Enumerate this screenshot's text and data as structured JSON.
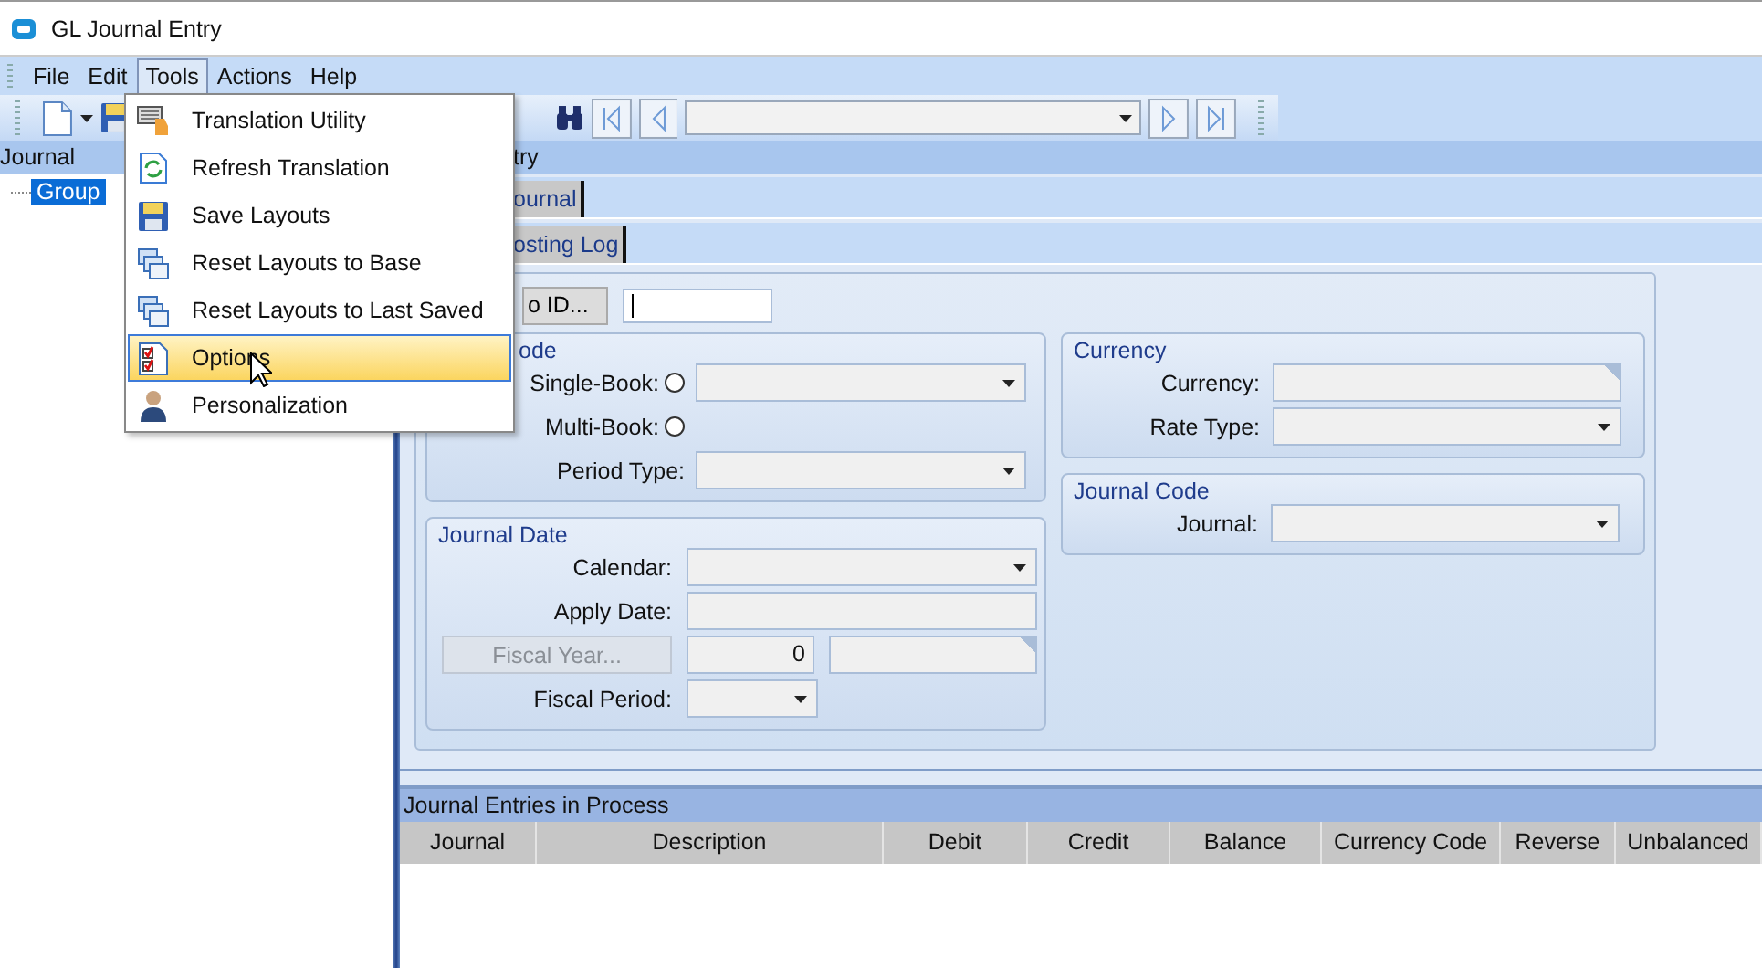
{
  "window": {
    "title": "GL Journal Entry"
  },
  "menu_bar": [
    {
      "label": "File",
      "selected": false
    },
    {
      "label": "Edit",
      "selected": false
    },
    {
      "label": "Tools",
      "selected": true
    },
    {
      "label": "Actions",
      "selected": false
    },
    {
      "label": "Help",
      "selected": false
    }
  ],
  "tools_menu": [
    {
      "label": "Translation Utility",
      "kind": "keyboard",
      "selected": false
    },
    {
      "label": "Refresh Translation",
      "kind": "refresh",
      "selected": false
    },
    {
      "label": "Save Layouts",
      "kind": "save",
      "selected": false
    },
    {
      "label": "Reset Layouts to Base",
      "kind": "windows",
      "selected": false
    },
    {
      "label": "Reset Layouts to Last Saved",
      "kind": "windows",
      "selected": false
    },
    {
      "label": "Options",
      "kind": "checklist",
      "selected": true
    },
    {
      "label": "Personalization",
      "kind": "person",
      "selected": false
    }
  ],
  "tree_pane": {
    "header": "Journal",
    "items": [
      {
        "label": "Group",
        "selected": true
      }
    ]
  },
  "content": {
    "title": "try",
    "tabs": [
      {
        "label": "ournal"
      },
      {
        "label": "osting Log"
      }
    ],
    "id_button": "o ID...",
    "groups": [
      {
        "title": "ode",
        "rows": [
          {
            "kind": "radio-dropdown",
            "label": "Single-Book:",
            "checked": false
          },
          {
            "kind": "radio",
            "label": "Multi-Book:",
            "checked": false
          },
          {
            "kind": "dropdown",
            "label": "Period Type:"
          }
        ]
      },
      {
        "title": "Journal Date",
        "rows": [
          {
            "kind": "dropdown",
            "label": "Calendar:"
          },
          {
            "kind": "text",
            "label": "Apply Date:"
          },
          {
            "kind": "button-fields",
            "button": "Fiscal Year...",
            "disabled": true,
            "value": "0"
          },
          {
            "kind": "small-dropdown",
            "label": "Fiscal Period:"
          }
        ]
      },
      {
        "title": "Currency",
        "rows": [
          {
            "kind": "lookup",
            "label": "Currency:"
          },
          {
            "kind": "dropdown",
            "label": "Rate Type:"
          }
        ]
      },
      {
        "title": "Journal Code",
        "rows": [
          {
            "kind": "dropdown",
            "label": "Journal:"
          }
        ]
      }
    ]
  },
  "grid": {
    "title": "Journal Entries in Process",
    "columns": [
      "Journal",
      "Description",
      "Debit",
      "Credit",
      "Balance",
      "Currency Code",
      "Reverse",
      "Unbalanced"
    ]
  }
}
